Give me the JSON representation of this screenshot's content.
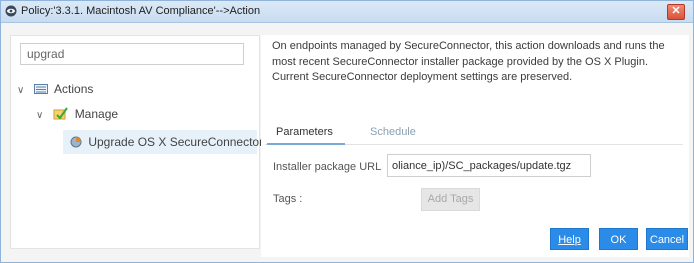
{
  "window": {
    "title": "Policy:'3.3.1. Macintosh AV Compliance'-->Action",
    "close_label": "✕"
  },
  "left": {
    "search_value": "upgrad",
    "tree": {
      "actions_label": "Actions",
      "manage_label": "Manage",
      "upgrade_label": "Upgrade OS X SecureConnector"
    }
  },
  "right": {
    "description_lines": [
      "On endpoints managed by SecureConnector, this action downloads and runs the",
      "most recent SecureConnector installer package provided by the OS X Plugin.",
      "Current SecureConnector deployment settings are preserved."
    ],
    "tabs": [
      {
        "label": "Parameters"
      },
      {
        "label": "Schedule"
      }
    ],
    "installer_label": "Installer package URL",
    "installer_value": "oliance_ip)/SC_packages/update.tgz",
    "tags_label": "Tags :",
    "add_tags_label": "Add Tags"
  },
  "buttons": {
    "help": "Help",
    "ok": "OK",
    "cancel": "Cancel"
  },
  "colors": {
    "accent": "#2a8ce8",
    "selection": "#e7f1f9",
    "titlebar": "#d3e4f5"
  }
}
